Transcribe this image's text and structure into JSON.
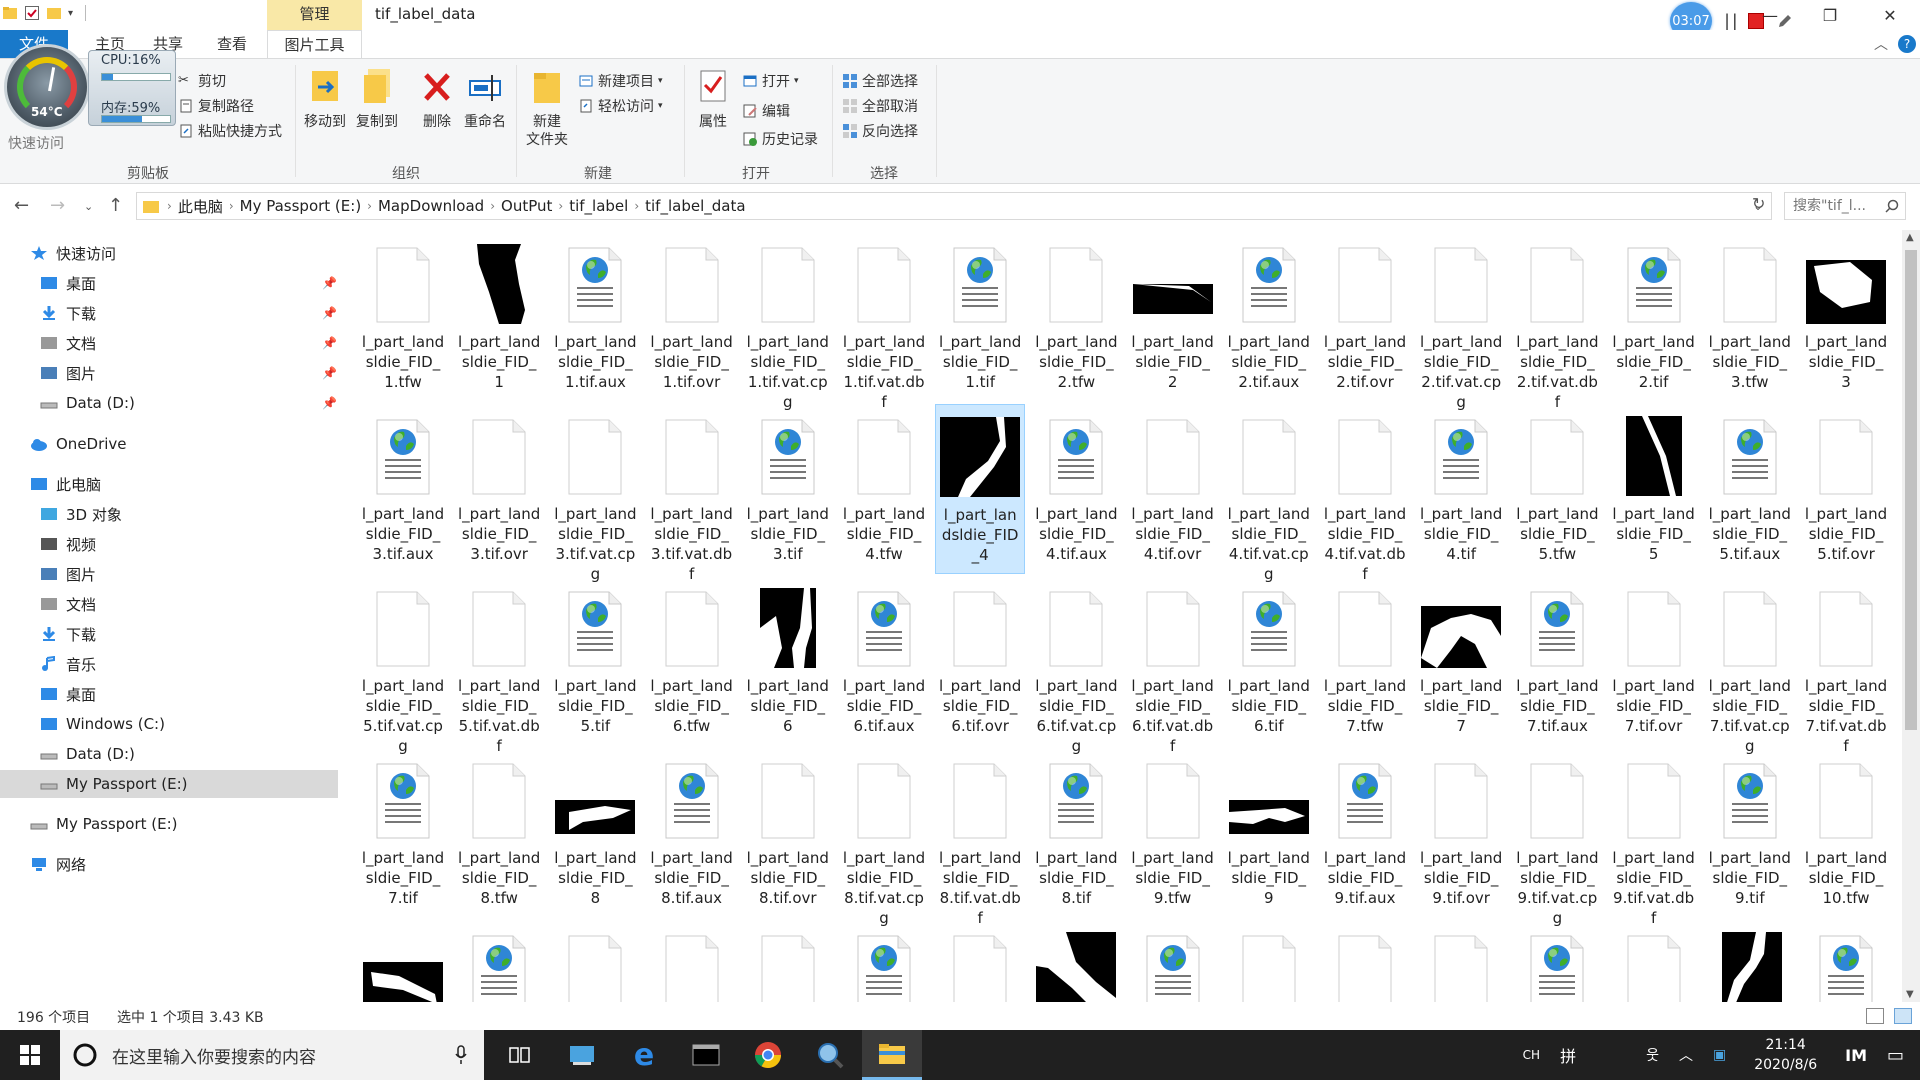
{
  "window": {
    "title": "tif_label_data",
    "context_tab": "管理"
  },
  "recorder": {
    "time": "03:07"
  },
  "ribbon_tabs": [
    "文件",
    "主页",
    "共享",
    "查看",
    "图片工具"
  ],
  "cpu_widget": {
    "cpu": "CPU:16%",
    "cpu_fraction": 0.16,
    "mem": "内存:59%",
    "mem_fraction": 0.59,
    "temp": "54°C"
  },
  "ribbon": {
    "clipboard": {
      "label": "剪贴板",
      "quick_access": "快速访问",
      "cut": "剪切",
      "copy_path": "复制路径",
      "paste_shortcut": "粘贴快捷方式"
    },
    "organize": {
      "label": "组织",
      "move_to": "移动到",
      "copy_to": "复制到",
      "delete": "删除",
      "rename": "重命名"
    },
    "new": {
      "label": "新建",
      "new_folder_1": "新建",
      "new_folder_2": "文件夹",
      "new_item": "新建项目",
      "easy_access": "轻松访问"
    },
    "open": {
      "label": "打开",
      "properties": "属性",
      "open": "打开",
      "edit": "编辑",
      "history": "历史记录"
    },
    "select": {
      "label": "选择",
      "select_all": "全部选择",
      "select_none": "全部取消",
      "invert": "反向选择"
    }
  },
  "address": {
    "crumbs": [
      "此电脑",
      "My Passport (E:)",
      "MapDownload",
      "OutPut",
      "tif_label",
      "tif_label_data"
    ],
    "search_placeholder": "搜索\"tif_l..."
  },
  "nav": [
    {
      "label": "快速访问",
      "icon": "star-icon",
      "pinned": false
    },
    {
      "label": "桌面",
      "icon": "desktop-icon",
      "pinned": true
    },
    {
      "label": "下载",
      "icon": "download-icon",
      "pinned": true
    },
    {
      "label": "文档",
      "icon": "document-icon",
      "pinned": true
    },
    {
      "label": "图片",
      "icon": "pictures-icon",
      "pinned": true
    },
    {
      "label": "Data (D:)",
      "icon": "drive-icon",
      "pinned": true
    },
    {
      "label": "OneDrive",
      "icon": "cloud-icon",
      "pinned": false
    },
    {
      "label": "此电脑",
      "icon": "computer-icon",
      "pinned": false
    },
    {
      "label": "3D 对象",
      "icon": "3d-objects-icon",
      "pinned": false
    },
    {
      "label": "视频",
      "icon": "video-icon",
      "pinned": false
    },
    {
      "label": "图片",
      "icon": "pictures-icon",
      "pinned": false
    },
    {
      "label": "文档",
      "icon": "document-icon",
      "pinned": false
    },
    {
      "label": "下载",
      "icon": "download-icon",
      "pinned": false
    },
    {
      "label": "音乐",
      "icon": "music-icon",
      "pinned": false
    },
    {
      "label": "桌面",
      "icon": "desktop-icon",
      "pinned": false
    },
    {
      "label": "Windows (C:)",
      "icon": "windows-drive-icon",
      "pinned": false
    },
    {
      "label": "Data (D:)",
      "icon": "drive-icon",
      "pinned": false
    },
    {
      "label": "My Passport (E:)",
      "icon": "drive-icon",
      "pinned": false,
      "selected": true
    },
    {
      "label": "My Passport (E:)",
      "icon": "drive-icon",
      "pinned": false
    },
    {
      "label": "网络",
      "icon": "network-icon",
      "pinned": false
    }
  ],
  "files": [
    {
      "name": "l_part_landsldie_FID_1.tfw",
      "kind": "blank"
    },
    {
      "name": "l_part_landsldie_FID_1",
      "kind": "mask1"
    },
    {
      "name": "l_part_landsldie_FID_1.tif.aux",
      "kind": "globe"
    },
    {
      "name": "l_part_landsldie_FID_1.tif.ovr",
      "kind": "blank"
    },
    {
      "name": "l_part_landsldie_FID_1.tif.vat.cpg",
      "kind": "blank"
    },
    {
      "name": "l_part_landsldie_FID_1.tif.vat.dbf",
      "kind": "blank"
    },
    {
      "name": "l_part_landsldie_FID_1.tif",
      "kind": "globe"
    },
    {
      "name": "l_part_landsldie_FID_2.tfw",
      "kind": "blank"
    },
    {
      "name": "l_part_landsldie_FID_2",
      "kind": "mask2"
    },
    {
      "name": "l_part_landsldie_FID_2.tif.aux",
      "kind": "globe"
    },
    {
      "name": "l_part_landsldie_FID_2.tif.ovr",
      "kind": "blank"
    },
    {
      "name": "l_part_landsldie_FID_2.tif.vat.cpg",
      "kind": "blank"
    },
    {
      "name": "l_part_landsldie_FID_2.tif.vat.dbf",
      "kind": "blank"
    },
    {
      "name": "l_part_landsldie_FID_2.tif",
      "kind": "globe"
    },
    {
      "name": "l_part_landsldie_FID_3.tfw",
      "kind": "blank"
    },
    {
      "name": "l_part_landsldie_FID_3",
      "kind": "mask3"
    },
    {
      "name": "l_part_landsldie_FID_3.tif.aux",
      "kind": "globe"
    },
    {
      "name": "l_part_landsldie_FID_3.tif.ovr",
      "kind": "blank"
    },
    {
      "name": "l_part_landsldie_FID_3.tif.vat.cpg",
      "kind": "blank"
    },
    {
      "name": "l_part_landsldie_FID_3.tif.vat.dbf",
      "kind": "blank"
    },
    {
      "name": "l_part_landsldie_FID_3.tif",
      "kind": "globe"
    },
    {
      "name": "l_part_landsldie_FID_4.tfw",
      "kind": "blank"
    },
    {
      "name": "l_part_landsldie_FID_4",
      "kind": "mask4",
      "selected": true
    },
    {
      "name": "l_part_landsldie_FID_4.tif.aux",
      "kind": "globe"
    },
    {
      "name": "l_part_landsldie_FID_4.tif.ovr",
      "kind": "blank"
    },
    {
      "name": "l_part_landsldie_FID_4.tif.vat.cpg",
      "kind": "blank"
    },
    {
      "name": "l_part_landsldie_FID_4.tif.vat.dbf",
      "kind": "blank"
    },
    {
      "name": "l_part_landsldie_FID_4.tif",
      "kind": "globe"
    },
    {
      "name": "l_part_landsldie_FID_5.tfw",
      "kind": "blank"
    },
    {
      "name": "l_part_landsldie_FID_5",
      "kind": "mask5"
    },
    {
      "name": "l_part_landsldie_FID_5.tif.aux",
      "kind": "globe"
    },
    {
      "name": "l_part_landsldie_FID_5.tif.ovr",
      "kind": "blank"
    },
    {
      "name": "l_part_landsldie_FID_5.tif.vat.cpg",
      "kind": "blank"
    },
    {
      "name": "l_part_landsldie_FID_5.tif.vat.dbf",
      "kind": "blank"
    },
    {
      "name": "l_part_landsldie_FID_5.tif",
      "kind": "globe"
    },
    {
      "name": "l_part_landsldie_FID_6.tfw",
      "kind": "blank"
    },
    {
      "name": "l_part_landsldie_FID_6",
      "kind": "mask6"
    },
    {
      "name": "l_part_landsldie_FID_6.tif.aux",
      "kind": "globe"
    },
    {
      "name": "l_part_landsldie_FID_6.tif.ovr",
      "kind": "blank"
    },
    {
      "name": "l_part_landsldie_FID_6.tif.vat.cpg",
      "kind": "blank"
    },
    {
      "name": "l_part_landsldie_FID_6.tif.vat.dbf",
      "kind": "blank"
    },
    {
      "name": "l_part_landsldie_FID_6.tif",
      "kind": "globe"
    },
    {
      "name": "l_part_landsldie_FID_7.tfw",
      "kind": "blank"
    },
    {
      "name": "l_part_landsldie_FID_7",
      "kind": "mask7"
    },
    {
      "name": "l_part_landsldie_FID_7.tif.aux",
      "kind": "globe"
    },
    {
      "name": "l_part_landsldie_FID_7.tif.ovr",
      "kind": "blank"
    },
    {
      "name": "l_part_landsldie_FID_7.tif.vat.cpg",
      "kind": "blank"
    },
    {
      "name": "l_part_landsldie_FID_7.tif.vat.dbf",
      "kind": "blank"
    },
    {
      "name": "l_part_landsldie_FID_7.tif",
      "kind": "globe"
    },
    {
      "name": "l_part_landsldie_FID_8.tfw",
      "kind": "blank"
    },
    {
      "name": "l_part_landsldie_FID_8",
      "kind": "mask8"
    },
    {
      "name": "l_part_landsldie_FID_8.tif.aux",
      "kind": "globe"
    },
    {
      "name": "l_part_landsldie_FID_8.tif.ovr",
      "kind": "blank"
    },
    {
      "name": "l_part_landsldie_FID_8.tif.vat.cpg",
      "kind": "blank"
    },
    {
      "name": "l_part_landsldie_FID_8.tif.vat.dbf",
      "kind": "blank"
    },
    {
      "name": "l_part_landsldie_FID_8.tif",
      "kind": "globe"
    },
    {
      "name": "l_part_landsldie_FID_9.tfw",
      "kind": "blank"
    },
    {
      "name": "l_part_landsldie_FID_9",
      "kind": "mask9"
    },
    {
      "name": "l_part_landsldie_FID_9.tif.aux",
      "kind": "globe"
    },
    {
      "name": "l_part_landsldie_FID_9.tif.ovr",
      "kind": "blank"
    },
    {
      "name": "l_part_landsldie_FID_9.tif.vat.cpg",
      "kind": "blank"
    },
    {
      "name": "l_part_landsldie_FID_9.tif.vat.dbf",
      "kind": "blank"
    },
    {
      "name": "l_part_landsldie_FID_9.tif",
      "kind": "globe"
    },
    {
      "name": "l_part_landsldie_FID_10.tfw",
      "kind": "blank"
    },
    {
      "name": "",
      "kind": "mask10"
    },
    {
      "name": "",
      "kind": "globe"
    },
    {
      "name": "",
      "kind": "blank"
    },
    {
      "name": "",
      "kind": "blank"
    },
    {
      "name": "",
      "kind": "blank"
    },
    {
      "name": "",
      "kind": "globe"
    },
    {
      "name": "",
      "kind": "blank"
    },
    {
      "name": "",
      "kind": "mask11"
    },
    {
      "name": "",
      "kind": "globe"
    },
    {
      "name": "",
      "kind": "blank"
    },
    {
      "name": "",
      "kind": "blank"
    },
    {
      "name": "",
      "kind": "blank"
    },
    {
      "name": "",
      "kind": "globe"
    },
    {
      "name": "",
      "kind": "blank"
    },
    {
      "name": "",
      "kind": "mask12"
    },
    {
      "name": "",
      "kind": "globe"
    }
  ],
  "status": {
    "count": "196 个项目",
    "selected": "选中 1 个项目  3.43 KB"
  },
  "taskbar": {
    "search_placeholder": "在这里输入你要搜索的内容",
    "ime_1": "CH",
    "ime_2": "拼",
    "time": "21:14",
    "date": "2020/8/6"
  }
}
